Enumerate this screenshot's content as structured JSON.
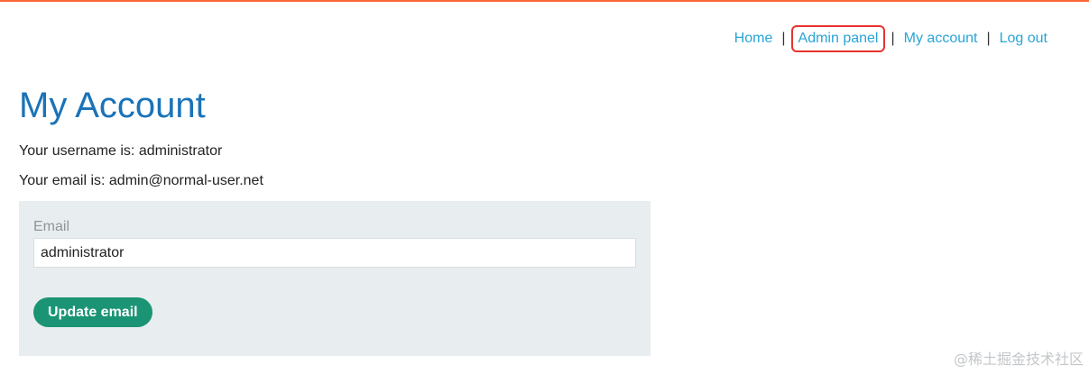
{
  "nav": {
    "items": [
      {
        "label": "Home"
      },
      {
        "label": "Admin panel"
      },
      {
        "label": "My account"
      },
      {
        "label": "Log out"
      }
    ],
    "separator": "|"
  },
  "page": {
    "title": "My Account",
    "username_line": "Your username is: administrator",
    "email_line": "Your email is: admin@normal-user.net"
  },
  "form": {
    "email_label": "Email",
    "email_value": "administrator",
    "submit_label": "Update email"
  },
  "watermark": "@稀土掘金技术社区",
  "colors": {
    "accent_bar": "#ff6633",
    "link": "#29a5d6",
    "title": "#1a73b8",
    "button": "#1a9474",
    "highlight_box": "#e8332e",
    "panel_bg": "#e8edef"
  }
}
